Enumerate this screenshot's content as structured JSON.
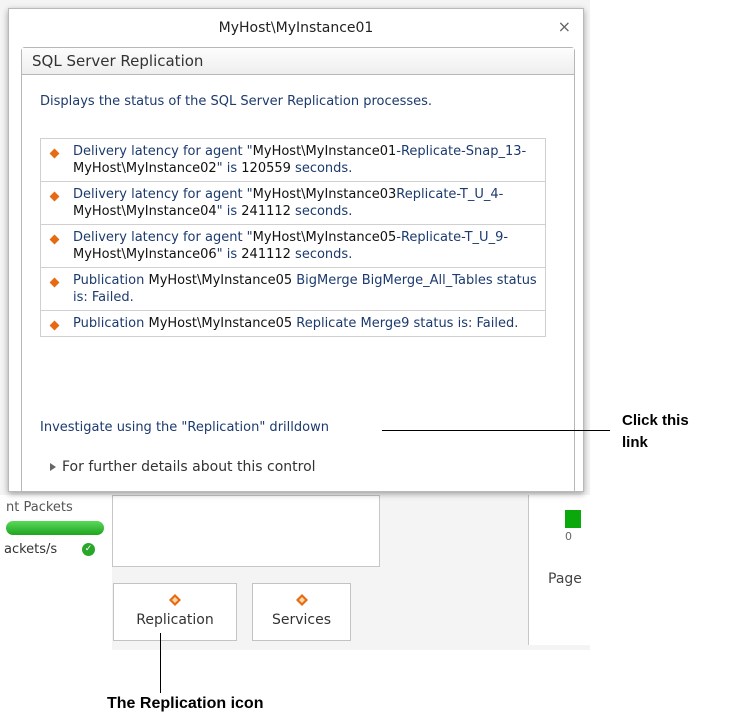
{
  "popup": {
    "title": "MyHost\\MyInstance01",
    "close_glyph": "×",
    "section_title": "SQL Server Replication",
    "description": "Displays the status of the SQL Server Replication processes.",
    "items": [
      [
        "Delivery latency for agent \"",
        "MyHost\\MyInstance01",
        "-Replicate-Snap_13-",
        "MyHost\\MyInstance02",
        "\" is ",
        "120559",
        " seconds."
      ],
      [
        "Delivery latency for agent \"",
        "MyHost\\MyInstance03",
        "Replicate-T_U_4- ",
        "MyHost\\MyInstance04",
        "\" is ",
        "241112",
        " seconds."
      ],
      [
        "Delivery latency for agent \"",
        "MyHost\\MyInstance05",
        "-Replicate-T_U_9-",
        "MyHost\\MyInstance06",
        "\" is ",
        "241112",
        " seconds."
      ],
      [
        "Publication ",
        "MyHost\\MyInstance05",
        "  BigMerge BigMerge_All_Tables status is: Failed.",
        "",
        "",
        "",
        ""
      ],
      [
        "Publication  ",
        "MyHost\\MyInstance05",
        " Replicate Merge9 status is: Failed.",
        "",
        "",
        "",
        ""
      ]
    ],
    "investigate_text": "Investigate using the \"Replication\" drilldown",
    "further_details": "For further details about this control"
  },
  "background": {
    "packets_label": "nt Packets",
    "packets_rate_label": "ackets/s",
    "axis_zero": "0",
    "page_label": "Page",
    "tiles": {
      "replication": "Replication",
      "services": "Services"
    }
  },
  "callouts": {
    "click_link_line1": "Click this",
    "click_link_line2": "link",
    "replication_icon": "The Replication icon"
  },
  "colors": {
    "accent": "#e56a12",
    "link_text": "#1c3a6e",
    "ok_green": "#2aa62a"
  }
}
